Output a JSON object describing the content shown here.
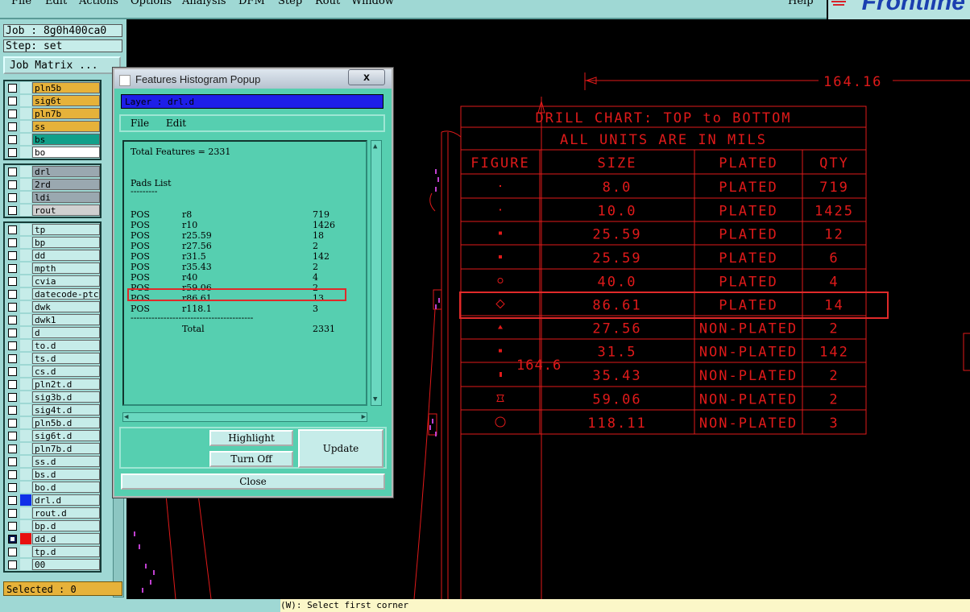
{
  "menubar": {
    "items": [
      "File",
      "Edit",
      "Actions",
      "Options",
      "Analysis",
      "DFM",
      "Step",
      "Rout",
      "Window"
    ],
    "help": "Help"
  },
  "brand": {
    "name": "Frontline"
  },
  "job": {
    "job_label": "Job : 8g0h400ca0",
    "step_label": "Step: set",
    "job_matrix": "Job Matrix ..."
  },
  "layers": [
    {
      "name": "pln5b",
      "color": "#e6b23a"
    },
    {
      "name": "sig6t",
      "color": "#e6b23a"
    },
    {
      "name": "pln7b",
      "color": "#e6b23a"
    },
    {
      "name": "ss",
      "color": "#e6b23a"
    },
    {
      "name": "bs",
      "color": "#12a08a"
    },
    {
      "name": "bo",
      "color": "#ffffff"
    },
    {
      "name": "drl",
      "color": "#9aa8b0"
    },
    {
      "name": "2rd",
      "color": "#9aa8b0"
    },
    {
      "name": "ldi",
      "color": "#9aa8b0"
    },
    {
      "name": "rout",
      "color": "#d0d0d0"
    },
    {
      "name": "tp",
      "color": "#c6ece9"
    },
    {
      "name": "bp",
      "color": "#c6ece9"
    },
    {
      "name": "dd",
      "color": "#c6ece9"
    },
    {
      "name": "mpth",
      "color": "#c6ece9"
    },
    {
      "name": "cvia",
      "color": "#c6ece9"
    },
    {
      "name": "datecode-ptc",
      "color": "#c6ece9"
    },
    {
      "name": "dwk",
      "color": "#c6ece9"
    },
    {
      "name": "dwk1",
      "color": "#c6ece9"
    },
    {
      "name": "d",
      "color": "#c6ece9"
    },
    {
      "name": "to.d",
      "color": "#c6ece9"
    },
    {
      "name": "ts.d",
      "color": "#c6ece9"
    },
    {
      "name": "cs.d",
      "color": "#c6ece9"
    },
    {
      "name": "pln2t.d",
      "color": "#c6ece9"
    },
    {
      "name": "sig3b.d",
      "color": "#c6ece9"
    },
    {
      "name": "sig4t.d",
      "color": "#c6ece9"
    },
    {
      "name": "pln5b.d",
      "color": "#c6ece9"
    },
    {
      "name": "sig6t.d",
      "color": "#c6ece9"
    },
    {
      "name": "pln7b.d",
      "color": "#c6ece9"
    },
    {
      "name": "ss.d",
      "color": "#c6ece9"
    },
    {
      "name": "bs.d",
      "color": "#c6ece9"
    },
    {
      "name": "bo.d",
      "color": "#c6ece9"
    },
    {
      "name": "drl.d",
      "color": "#c6ece9"
    },
    {
      "name": "rout.d",
      "color": "#c6ece9"
    },
    {
      "name": "bp.d",
      "color": "#c6ece9"
    },
    {
      "name": "dd.d",
      "color": "#c6ece9"
    },
    {
      "name": "tp.d",
      "color": "#c6ece9"
    },
    {
      "name": "00",
      "color": "#c6ece9"
    }
  ],
  "selected_label": "Selected : 0",
  "command_line": "(W): Select first corner",
  "popup": {
    "title": "Features Histogram Popup",
    "close_glyph": "x",
    "layer_label": "Layer :  drl.d",
    "menu": [
      "File",
      "Edit"
    ],
    "total_features": "Total Features = 2331",
    "pads_heading": "Pads List",
    "pads_underline": "---------",
    "rows": [
      {
        "pol": "POS",
        "sym": "r8",
        "count": "719"
      },
      {
        "pol": "POS",
        "sym": "r10",
        "count": "1426"
      },
      {
        "pol": "POS",
        "sym": "r25.59",
        "count": "18"
      },
      {
        "pol": "POS",
        "sym": "r27.56",
        "count": "2"
      },
      {
        "pol": "POS",
        "sym": "r31.5",
        "count": "142"
      },
      {
        "pol": "POS",
        "sym": "r35.43",
        "count": "2"
      },
      {
        "pol": "POS",
        "sym": "r40",
        "count": "4"
      },
      {
        "pol": "POS",
        "sym": "r59.06",
        "count": "2"
      },
      {
        "pol": "POS",
        "sym": "r86.61",
        "count": "13"
      },
      {
        "pol": "POS",
        "sym": "r118.1",
        "count": "3"
      }
    ],
    "divider": "-----------------------------------------",
    "total_label": "Total",
    "total_value": "2331",
    "buttons": {
      "highlight": "Highlight",
      "turn_off": "Turn Off",
      "update": "Update",
      "close": "Close"
    }
  },
  "drill_chart": {
    "dim_top": "164.16",
    "dim_side": "164.6",
    "title": "DRILL CHART: TOP to BOTTOM",
    "subtitle": "ALL UNITS ARE IN MILS",
    "headers": [
      "FIGURE",
      "SIZE",
      "PLATED",
      "QTY"
    ],
    "rows": [
      {
        "figure": "dot-small",
        "size": "8.0",
        "plated": "PLATED",
        "qty": "719"
      },
      {
        "figure": "dot-tiny",
        "size": "10.0",
        "plated": "PLATED",
        "qty": "1425"
      },
      {
        "figure": "square-small",
        "size": "25.59",
        "plated": "PLATED",
        "qty": "12"
      },
      {
        "figure": "square-small",
        "size": "25.59",
        "plated": "PLATED",
        "qty": "6"
      },
      {
        "figure": "circle-small",
        "size": "40.0",
        "plated": "PLATED",
        "qty": "4"
      },
      {
        "figure": "diamond",
        "size": "86.61",
        "plated": "PLATED",
        "qty": "14"
      },
      {
        "figure": "triangle",
        "size": "27.56",
        "plated": "NON-PLATED",
        "qty": "2"
      },
      {
        "figure": "square-small",
        "size": "31.5",
        "plated": "NON-PLATED",
        "qty": "142"
      },
      {
        "figure": "bar",
        "size": "35.43",
        "plated": "NON-PLATED",
        "qty": "2"
      },
      {
        "figure": "hourglass",
        "size": "59.06",
        "plated": "NON-PLATED",
        "qty": "2"
      },
      {
        "figure": "circle-large",
        "size": "118.11",
        "plated": "NON-PLATED",
        "qty": "3"
      }
    ],
    "line_color": "#e01a1a"
  }
}
